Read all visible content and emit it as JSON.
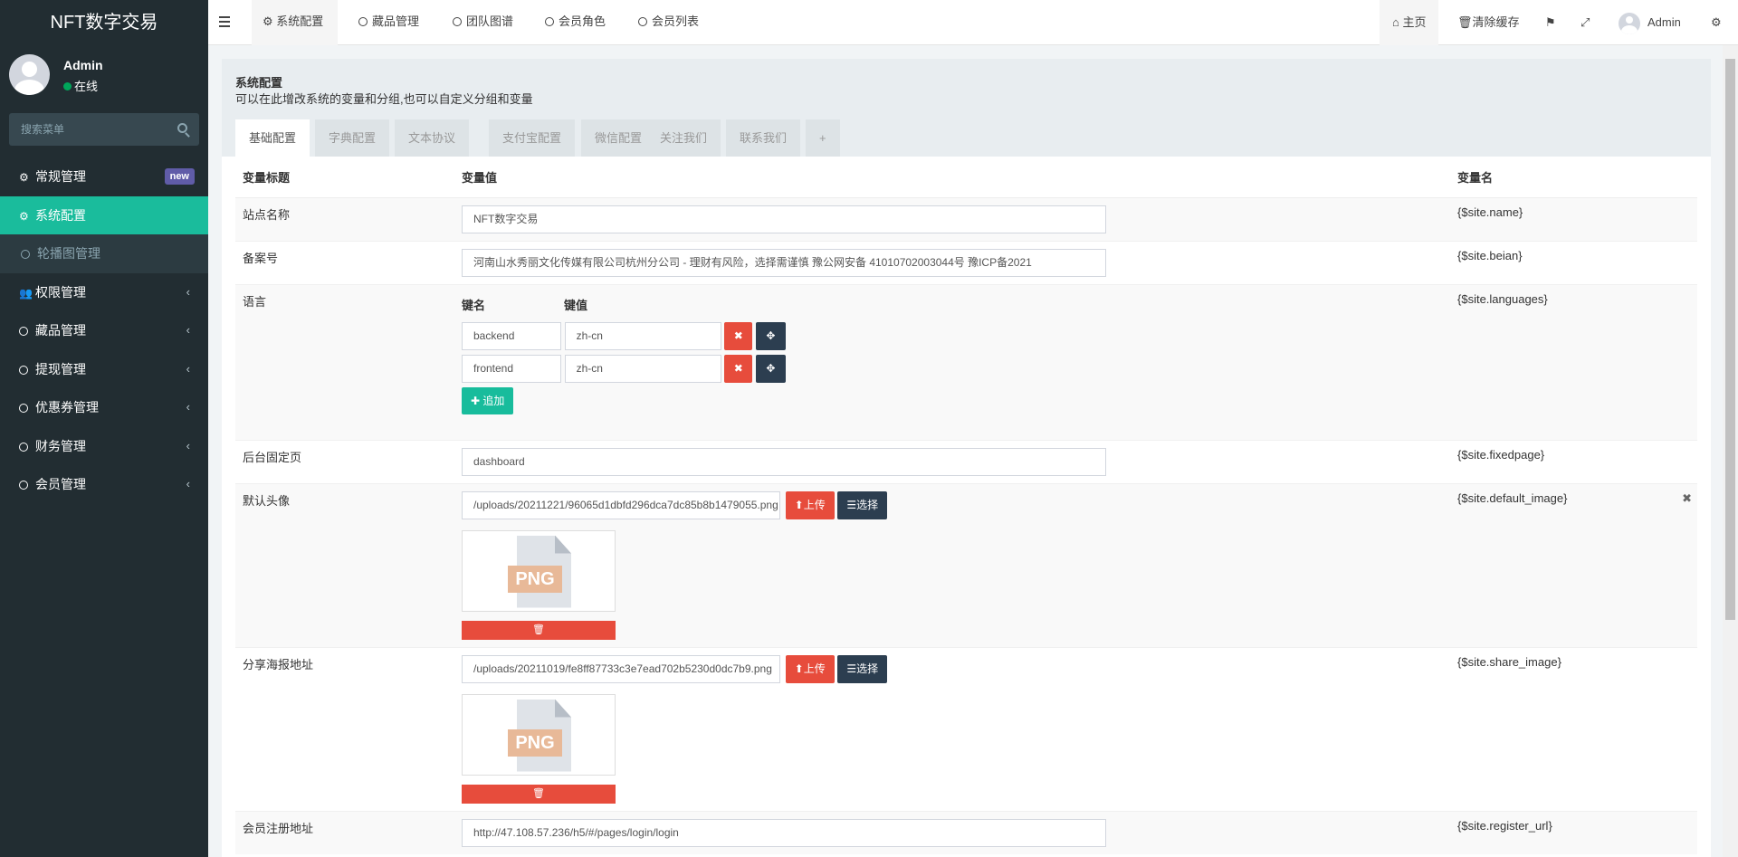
{
  "app": {
    "logo": "NFT数字交易"
  },
  "user": {
    "name": "Admin",
    "status": "在线"
  },
  "sidebar": {
    "search_placeholder": "搜索菜单",
    "items": [
      {
        "label": "常规管理",
        "badge": "new"
      },
      {
        "label": "系统配置"
      },
      {
        "label": "轮播图管理"
      },
      {
        "label": "权限管理"
      },
      {
        "label": "藏品管理"
      },
      {
        "label": "提现管理"
      },
      {
        "label": "优惠券管理"
      },
      {
        "label": "财务管理"
      },
      {
        "label": "会员管理"
      }
    ]
  },
  "topnav": {
    "tabs": [
      "系统配置",
      "藏品管理",
      "团队图谱",
      "会员角色",
      "会员列表"
    ],
    "home": "主页",
    "clear_cache": "清除缓存",
    "user": "Admin"
  },
  "panel": {
    "title": "系统配置",
    "desc": "可以在此增改系统的变量和分组,也可以自定义分组和变量",
    "tabs": [
      "基础配置",
      "字典配置",
      "文本协议",
      "支付宝配置",
      "微信配置",
      "关注我们",
      "联系我们",
      "+"
    ]
  },
  "table": {
    "headers": {
      "title": "变量标题",
      "value": "变量值",
      "name": "变量名"
    },
    "rows": {
      "site_name": {
        "title": "站点名称",
        "value": "NFT数字交易",
        "var": "{$site.name}"
      },
      "beian": {
        "title": "备案号",
        "value": "河南山水秀丽文化传媒有限公司杭州分公司 - 理财有风险，选择需谨慎      豫公网安备 41010702003044号          豫ICP备2021",
        "var": "{$site.beian}"
      },
      "languages": {
        "title": "语言",
        "var": "{$site.languages}",
        "key_header": "键名",
        "value_header": "键值",
        "entries": [
          {
            "key": "backend",
            "value": "zh-cn"
          },
          {
            "key": "frontend",
            "value": "zh-cn"
          }
        ],
        "add_label": "追加"
      },
      "fixedpage": {
        "title": "后台固定页",
        "value": "dashboard",
        "var": "{$site.fixedpage}"
      },
      "default_image": {
        "title": "默认头像",
        "value": "/uploads/20211221/96065d1dbfd296dca7dc85b8b1479055.png",
        "var": "{$site.default_image}",
        "upload": "上传",
        "choose": "选择",
        "file_type": "PNG"
      },
      "share_image": {
        "title": "分享海报地址",
        "value": "/uploads/20211019/fe8ff87733c3e7ead702b5230d0dc7b9.png",
        "var": "{$site.share_image}",
        "upload": "上传",
        "choose": "选择",
        "file_type": "PNG"
      },
      "register_url": {
        "title": "会员注册地址",
        "value": "http://47.108.57.236/h5/#/pages/login/login",
        "var": "{$site.register_url}"
      }
    }
  }
}
